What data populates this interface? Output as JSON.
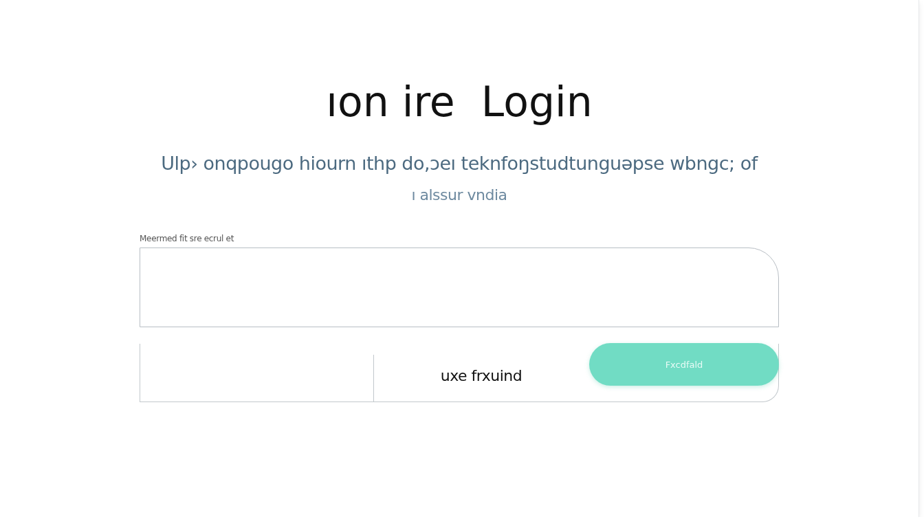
{
  "title": "ıon ire  Login",
  "subtitle": [
    "Ulp› onqpougo hiourn ıthp do,ɔeı teknfoŋstudtunguəpse wbngc; of",
    "ı alssur vndia"
  ],
  "field": {
    "label": "Meermed fit sre ecrul et"
  },
  "lower_row": {
    "text": "uxe frxuind",
    "button": "Fxcdfald"
  }
}
